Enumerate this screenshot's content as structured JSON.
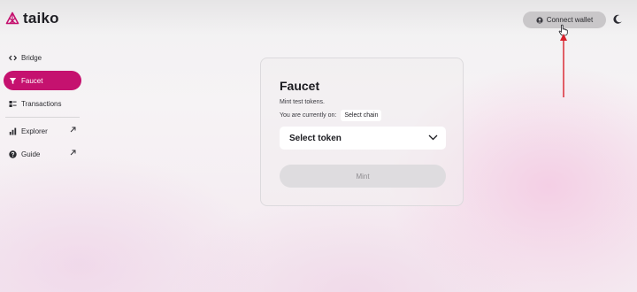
{
  "header": {
    "logo_text": "taiko",
    "connect_wallet_label": "Connect wallet",
    "icons": {
      "logo": "taiko-logo-icon",
      "connect": "person-icon",
      "theme": "moon-icon"
    }
  },
  "sidebar": {
    "items": [
      {
        "label": "Bridge",
        "icon": "bridge-icon"
      },
      {
        "label": "Faucet",
        "icon": "funnel-icon",
        "active": true
      },
      {
        "label": "Transactions",
        "icon": "transactions-icon"
      },
      {
        "label": "Explorer",
        "icon": "bar-chart-icon",
        "external": true
      },
      {
        "label": "Guide",
        "icon": "help-circle-icon",
        "external": true
      }
    ]
  },
  "faucet": {
    "title": "Faucet",
    "description": "Mint test tokens.",
    "chain_prefix": "You are currently on:",
    "select_chain_label": "Select chain",
    "select_token_label": "Select token",
    "mint_label": "Mint"
  },
  "colors": {
    "accent": "#c5126f",
    "annotation_arrow": "#d8202a"
  }
}
